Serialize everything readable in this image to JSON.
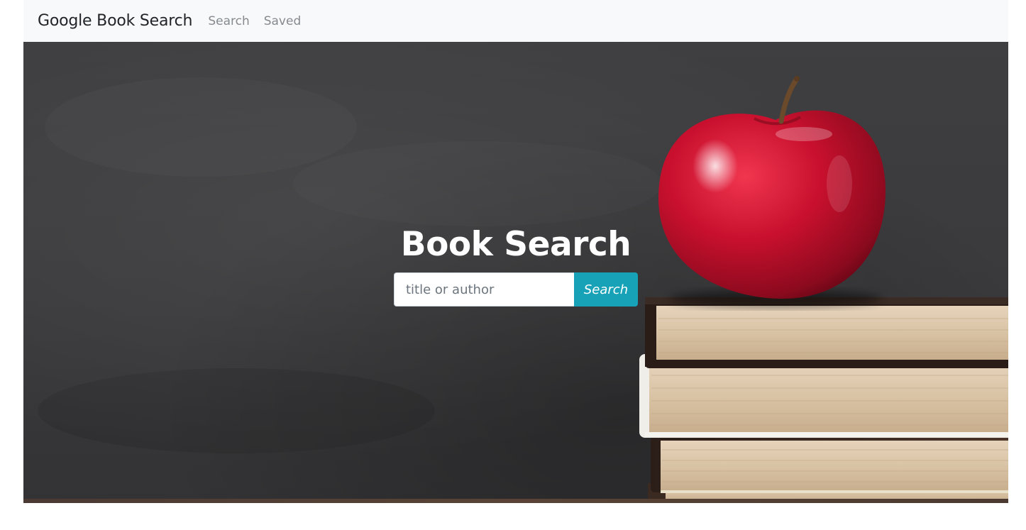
{
  "navbar": {
    "brand": "Google Book Search",
    "links": [
      {
        "label": "Search"
      },
      {
        "label": "Saved"
      }
    ]
  },
  "hero": {
    "title": "Book Search",
    "search": {
      "placeholder": "title or author",
      "value": "",
      "button_label": "Search"
    },
    "background_image": "apple-on-books-chalkboard"
  },
  "colors": {
    "navbar_bg": "#f8f9fa",
    "button_accent": "#17a2b8",
    "chalkboard": "#3a3a3c",
    "apple": "#c8102e"
  }
}
